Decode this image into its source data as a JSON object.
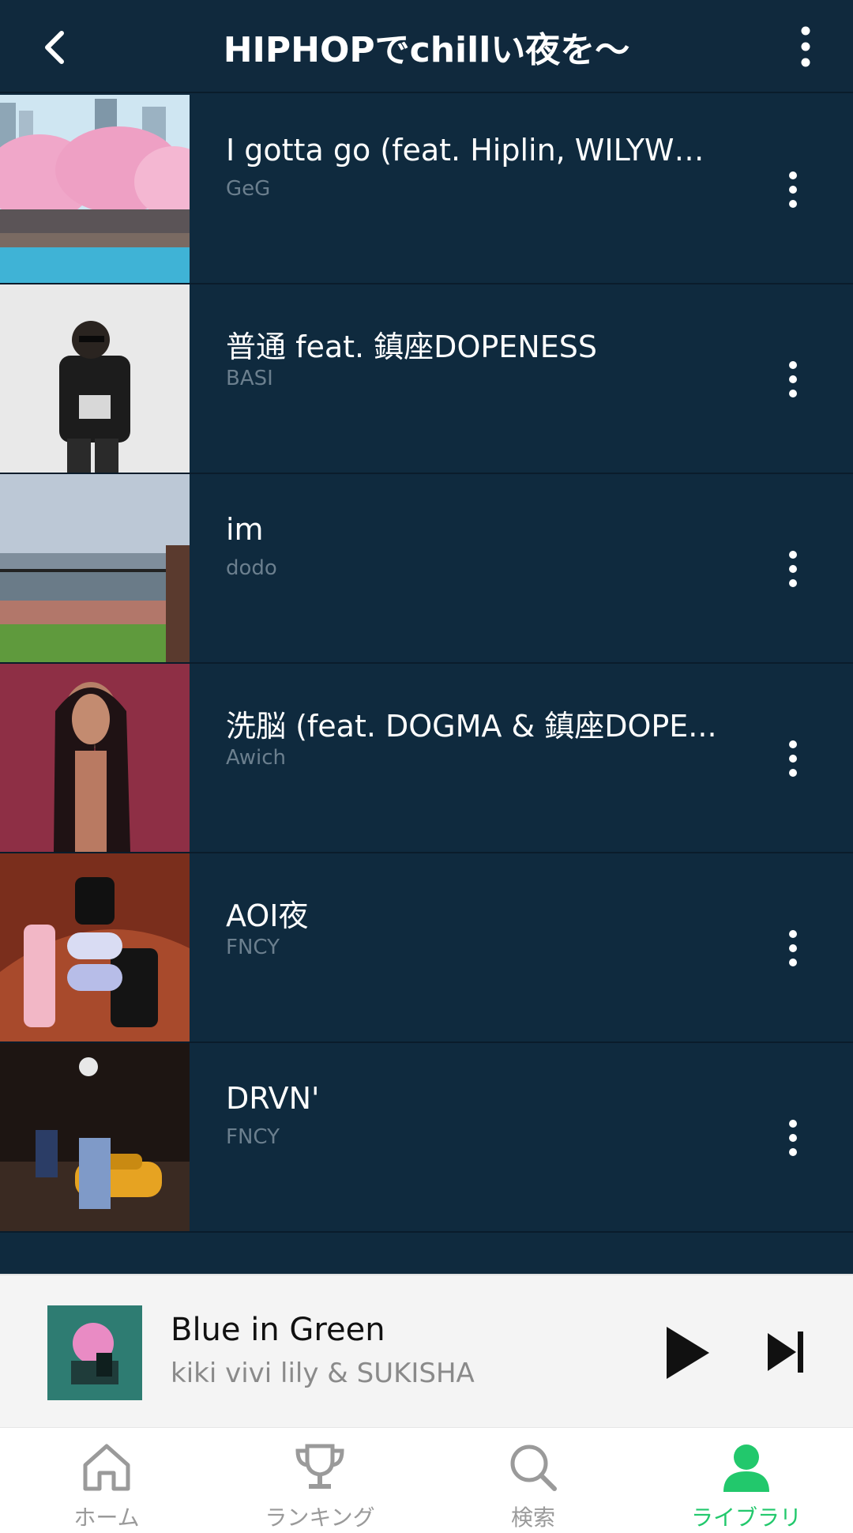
{
  "header": {
    "title": "HIPHOPでchillい夜を〜"
  },
  "tracks": [
    {
      "title": "I gotta go (feat. Hiplin, WILYWN...",
      "artist": "GeG"
    },
    {
      "title": "普通 feat. 鎮座DOPENESS",
      "artist": "BASI"
    },
    {
      "title": "im",
      "artist": "dodo"
    },
    {
      "title": "洗脳 (feat. DOGMA & 鎮座DOPE...",
      "artist": "Awich"
    },
    {
      "title": "AOI夜",
      "artist": "FNCY"
    },
    {
      "title": "DRVN'",
      "artist": "FNCY"
    }
  ],
  "player": {
    "title": "Blue in Green",
    "artist": "kiki vivi lily & SUKISHA"
  },
  "nav": [
    {
      "label": "ホーム",
      "icon": "home-icon"
    },
    {
      "label": "ランキング",
      "icon": "trophy-icon"
    },
    {
      "label": "検索",
      "icon": "search-icon"
    },
    {
      "label": "ライブラリ",
      "icon": "user-icon",
      "active": true
    }
  ],
  "colors": {
    "background": "#0f2a3e",
    "accent": "#22c86c",
    "artist_text": "#6b7f8e"
  }
}
